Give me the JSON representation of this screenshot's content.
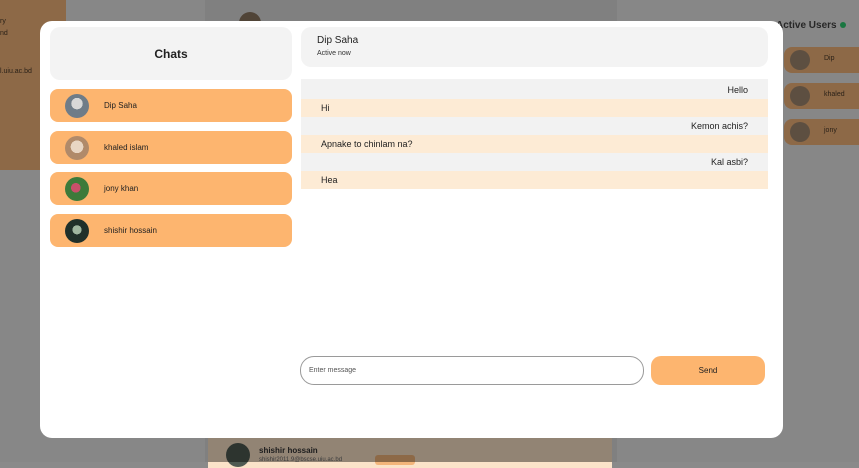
{
  "background": {
    "left_card_lines": [
      "ry",
      "nd",
      "l.uiu.ac.bd"
    ],
    "bottom_card": {
      "name": "shishir hossain",
      "email": "shishir2011.9@bscse.uiu.ac.bd"
    },
    "active_users": {
      "title": "Active Users",
      "items": [
        {
          "name": "Dip"
        },
        {
          "name": "khaled"
        },
        {
          "name": "jony"
        }
      ]
    }
  },
  "chats_panel": {
    "title": "Chats",
    "items": [
      {
        "name": "Dip Saha"
      },
      {
        "name": "khaled islam"
      },
      {
        "name": "jony khan"
      },
      {
        "name": "shishir hossain"
      }
    ]
  },
  "conversation": {
    "contact_name": "Dip Saha",
    "status": "Active now",
    "messages": [
      {
        "text": "Hello",
        "direction": "sent"
      },
      {
        "text": "Hi",
        "direction": "received"
      },
      {
        "text": "Kemon achis?",
        "direction": "sent"
      },
      {
        "text": "Apnake to chinlam na?",
        "direction": "received"
      },
      {
        "text": "Kal asbi?",
        "direction": "sent"
      },
      {
        "text": "Hea",
        "direction": "received"
      }
    ]
  },
  "composer": {
    "placeholder": "Enter message",
    "send_label": "Send"
  },
  "colors": {
    "accent": "#fdb56f",
    "received_bubble": "#fdebd5",
    "sent_bubble": "#f2f2f2",
    "online": "#2ecc71"
  }
}
